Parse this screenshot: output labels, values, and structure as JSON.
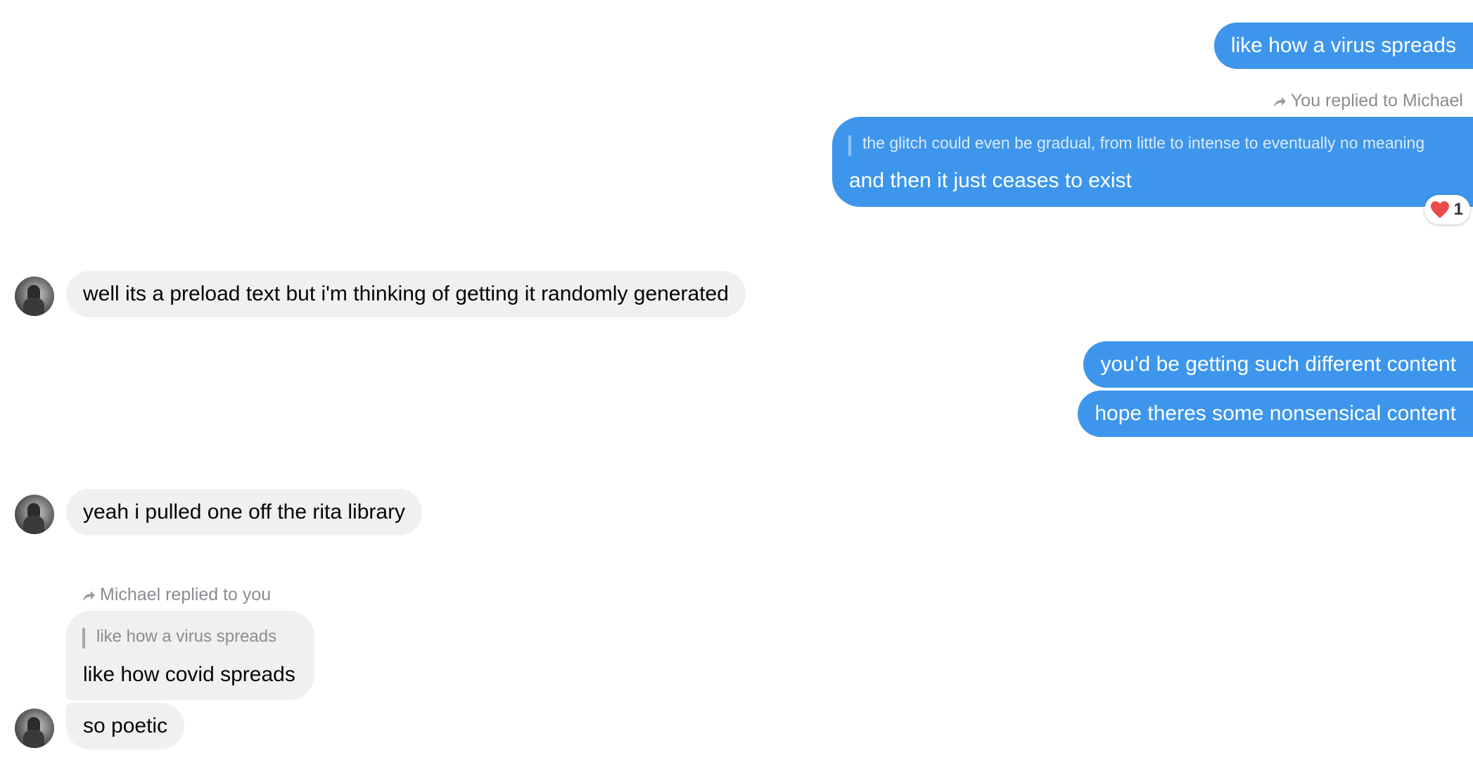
{
  "messages": {
    "m1": "like how a virus spreads",
    "m2_reply_label": "You replied to Michael",
    "m2_quote": "the glitch could even be gradual, from little to intense to eventually no meaning",
    "m2_text": "and then it just ceases to exist",
    "m2_reaction_count": "1",
    "m3": "well its a preload text but i'm thinking of getting it randomly generated",
    "m4": "you'd be getting such different content",
    "m5": "hope theres some nonsensical content",
    "m6": "yeah i pulled one off the rita library",
    "m7_reply_label": "Michael replied to you",
    "m7_quote": "like how a virus spreads",
    "m7_text": "like how covid spreads",
    "m8": "so poetic"
  },
  "colors": {
    "mine_bubble": "#3d96ec",
    "theirs_bubble": "#f0f0f0",
    "reply_label": "#8a8d91",
    "reaction_heart": "#e94b4b"
  },
  "icons": {
    "reply": "reply-arrow-icon",
    "reaction": "heart-icon",
    "avatar": "avatar"
  }
}
